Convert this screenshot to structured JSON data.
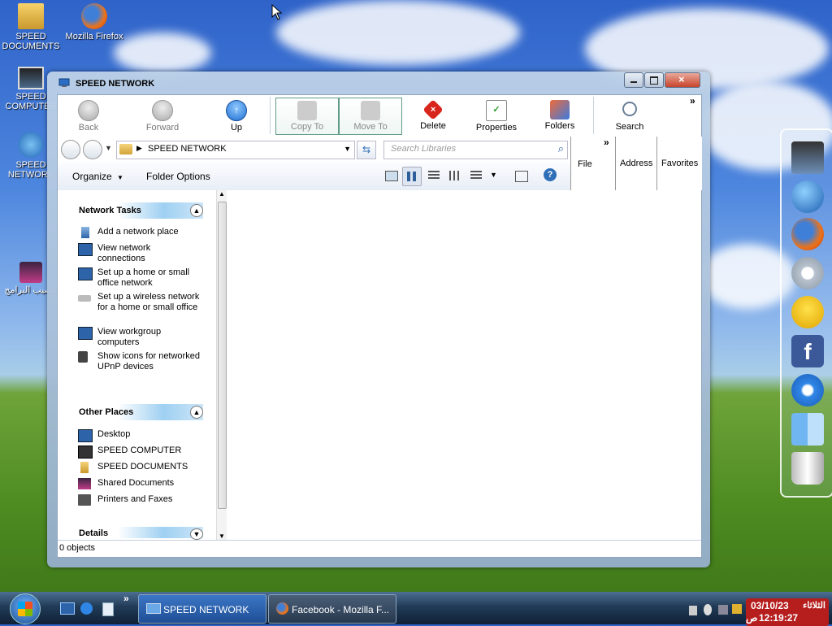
{
  "desktop": {
    "icons": [
      {
        "label": "SPEED DOCUMENTS"
      },
      {
        "label": "Mozilla Firefox"
      },
      {
        "label": "SPEED COMPUTER"
      },
      {
        "label": "SPEED NETWORK"
      },
      {
        "label": "تنصيب البرامج"
      }
    ]
  },
  "window": {
    "title": "SPEED NETWORK",
    "toolbar": {
      "back": "Back",
      "forward": "Forward",
      "up": "Up",
      "copy_to": "Copy To",
      "move_to": "Move To",
      "delete": "Delete",
      "properties": "Properties",
      "folders": "Folders",
      "search": "Search",
      "overflow": "»"
    },
    "address": {
      "path": "SPEED NETWORK",
      "search_placeholder": "Search Libraries"
    },
    "menus": {
      "file": "File",
      "address": "Address",
      "favorites": "Favorites",
      "overflow": "»"
    },
    "commandbar": {
      "organize": "Organize",
      "folder_options": "Folder Options"
    },
    "network_tasks": {
      "heading": "Network Tasks",
      "items": [
        {
          "label": "Add a network place"
        },
        {
          "label": "View network connections"
        },
        {
          "label": "Set up a home or small office network"
        },
        {
          "label": "Set up a wireless network for a home or small office"
        },
        {
          "label": "View workgroup computers"
        },
        {
          "label": "Show icons for networked UPnP devices"
        }
      ]
    },
    "other_places": {
      "heading": "Other Places",
      "items": [
        {
          "label": "Desktop"
        },
        {
          "label": "SPEED COMPUTER"
        },
        {
          "label": "SPEED DOCUMENTS"
        },
        {
          "label": "Shared Documents"
        },
        {
          "label": "Printers and Faxes"
        }
      ]
    },
    "details": {
      "heading": "Details"
    },
    "status": "0 objects"
  },
  "taskbar": {
    "buttons": [
      {
        "label": "SPEED NETWORK"
      },
      {
        "label": "Facebook - Mozilla F..."
      }
    ],
    "overflow": "»",
    "clock": {
      "day": "الثلاثاء",
      "date": "03/10/23",
      "ampm": "ص",
      "time": "12:19:27"
    }
  },
  "colors": {
    "accent": "#3a8ee6",
    "delete": "#d9261c",
    "taskbar": "#1a3350"
  }
}
